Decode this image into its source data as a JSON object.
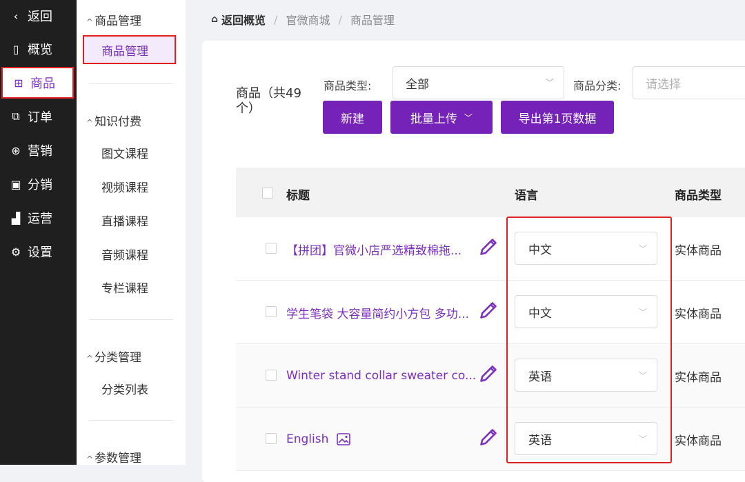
{
  "nav": {
    "items": [
      {
        "label": "返回",
        "icon": "‹"
      },
      {
        "label": "概览",
        "icon": "▯"
      },
      {
        "label": "商品",
        "icon": "⊞"
      },
      {
        "label": "订单",
        "icon": "⧉"
      },
      {
        "label": "营销",
        "icon": "⊕"
      },
      {
        "label": "分销",
        "icon": "▣"
      },
      {
        "label": "运营",
        "icon": "▟"
      },
      {
        "label": "设置",
        "icon": "⚙"
      }
    ]
  },
  "subnav": {
    "group_goods": "商品管理",
    "item_goods": "商品管理",
    "group_knowledge": "知识付费",
    "knowledge_items": [
      "图文课程",
      "视频课程",
      "直播课程",
      "音频课程",
      "专栏课程"
    ],
    "group_category": "分类管理",
    "item_category_list": "分类列表",
    "group_params": "参数管理"
  },
  "breadcrumb": {
    "home": "返回概览",
    "level1": "官微商城",
    "level2": "商品管理",
    "sep": "/"
  },
  "toolbar": {
    "count_label": "商品（共49个）",
    "type_label": "商品类型:",
    "type_value": "全部",
    "category_label": "商品分类:",
    "category_placeholder": "请选择",
    "new_button": "新建",
    "bulk_upload_button": "批量上传",
    "export_button": "导出第1页数据"
  },
  "table": {
    "headers": {
      "title": "标题",
      "language": "语言",
      "type": "商品类型"
    },
    "rows": [
      {
        "title": "【拼团】官微小店严选精致棉拖...",
        "language": "中文",
        "type": "实体商品"
      },
      {
        "title": "学生笔袋 大容量简约小方包 多功...",
        "language": "中文",
        "type": "实体商品"
      },
      {
        "title": "Winter stand collar sweater co...",
        "language": "英语",
        "type": "实体商品"
      },
      {
        "title": "English",
        "language": "英语",
        "type": "实体商品"
      }
    ]
  },
  "colors": {
    "accent": "#7522b8",
    "highlight": "#e02020",
    "nav_bg": "#1f1f1f"
  }
}
